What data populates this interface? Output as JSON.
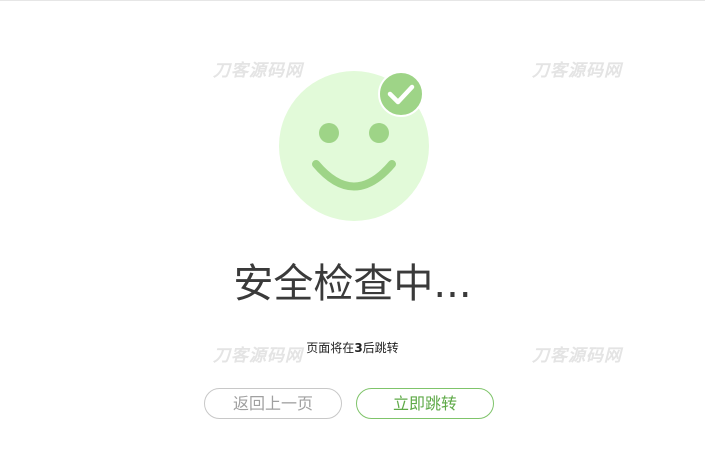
{
  "watermarks": [
    "刀客源码网",
    "刀客源码网",
    "刀客源码网",
    "刀客源码网"
  ],
  "icons": {
    "smiley": "smiley-face-icon",
    "check": "check-icon"
  },
  "colors": {
    "face_fill": "#e2fad9",
    "face_features": "#9ed487",
    "check_badge": "#9ed487",
    "primary_green": "#5faa48",
    "title_text": "#3a3a3a",
    "muted_border": "#c8c8c8"
  },
  "main": {
    "title": "安全检查中...",
    "countdown": {
      "prefix": "页面将在",
      "seconds": "3",
      "suffix": "后跳转"
    }
  },
  "buttons": {
    "back_label": "返回上一页",
    "go_label": "立即跳转"
  }
}
